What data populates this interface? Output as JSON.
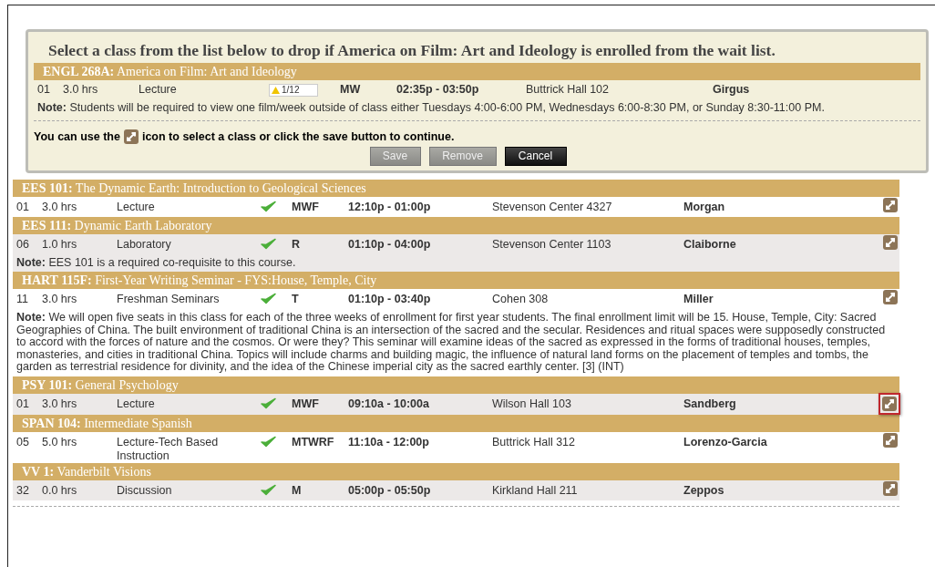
{
  "dialog": {
    "title": "Select a class from the list below to drop if America on Film: Art and Ideology is enrolled from the wait list.",
    "course": {
      "header": "**ENGL 268A:** America on Film: Art and Ideology",
      "section": "01",
      "hours": "3.0 hrs",
      "type": "Lecture",
      "waitlist": "1/12",
      "days": "MW",
      "time": "02:35p - 03:50p",
      "location": "Buttrick Hall 102",
      "instructor": "Girgus",
      "note": "**Note:** Students will be required to view one film/week outside of class either Tuesdays 4:00-6:00 PM, Wednesdays 6:00-8:30 PM, or Sunday 8:30-11:00 PM."
    },
    "instruction_before": "You can use the",
    "instruction_after": "icon to select a class or click the save button to continue.",
    "buttons": [
      {
        "label": "Save",
        "disabled": true
      },
      {
        "label": "Remove",
        "disabled": true
      },
      {
        "label": "Cancel",
        "disabled": false
      }
    ]
  },
  "classes": [
    {
      "header": "**EES 101:** The Dynamic Earth: Introduction to Geological Sciences",
      "section": "01",
      "hours": "3.0 hrs",
      "type": "Lecture",
      "days": "MWF",
      "time": "12:10p - 01:00p",
      "location": "Stevenson Center 4327",
      "instructor": "Morgan",
      "selected": false
    },
    {
      "header": "**EES 111:** Dynamic Earth Laboratory",
      "section": "06",
      "hours": "1.0 hrs",
      "type": "Laboratory",
      "days": "R",
      "time": "01:10p - 04:00p",
      "location": "Stevenson Center 1103",
      "instructor": "Claiborne",
      "note": "**Note:** EES 101 is a required co-requisite to this course.",
      "selected": false
    },
    {
      "header": "**HART 115F:** First-Year Writing Seminar - FYS:House, Temple, City",
      "section": "11",
      "hours": "3.0 hrs",
      "type": "Freshman Seminars",
      "days": "T",
      "time": "01:10p - 03:40p",
      "location": "Cohen 308",
      "instructor": "Miller",
      "note": "**Note:** We will open five seats in this class for each of the three weeks of enrollment for first year students. The final enrollment limit will be 15.   House, Temple, City: Sacred Geographies of China. The built environment of traditional China is an intersection of the sacred and the secular. Residences and ritual spaces were supposedly constructed to accord with the forces of nature and the cosmos. Or were they? This seminar will examine ideas of the sacred as expressed in the forms of traditional houses, temples, monasteries, and cities in traditional China. Topics will include charms and building magic, the influence of natural land forms on the placement of temples and tombs, the garden as terrestrial residence for divinity, and the idea of the Chinese imperial city as the sacred earthly center. [3] (INT)",
      "selected": false
    },
    {
      "header": "**PSY 101:** General Psychology",
      "section": "01",
      "hours": "3.0 hrs",
      "type": "Lecture",
      "days": "MWF",
      "time": "09:10a - 10:00a",
      "location": "Wilson Hall 103",
      "instructor": "Sandberg",
      "selected": true
    },
    {
      "header": "**SPAN 104:** Intermediate Spanish",
      "section": "05",
      "hours": "5.0 hrs",
      "type": "Lecture-Tech Based Instruction",
      "days": "MTWRF",
      "time": "11:10a - 12:00p",
      "location": "Buttrick Hall 312",
      "instructor": "Lorenzo-Garcia",
      "selected": false
    },
    {
      "header": "**VV 1:** Vanderbilt Visions",
      "section": "32",
      "hours": "0.0 hrs",
      "type": "Discussion",
      "days": "M",
      "time": "05:00p - 05:50p",
      "location": "Kirkland Hall 211",
      "instructor": "Zeppos",
      "selected": false
    }
  ]
}
